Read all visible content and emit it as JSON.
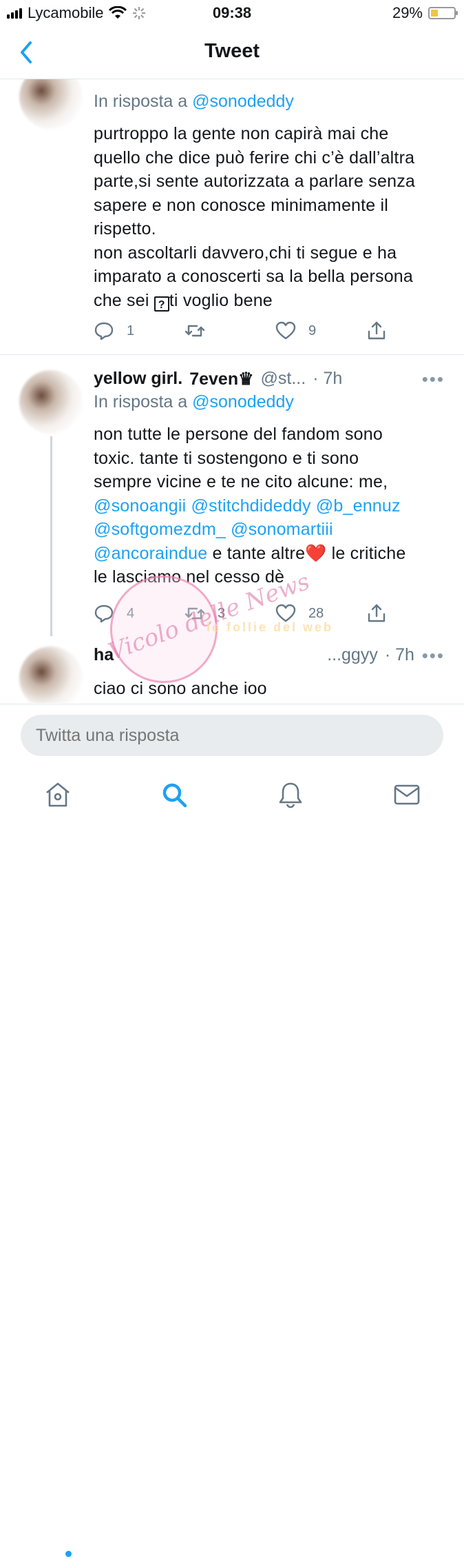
{
  "status_bar": {
    "carrier": "Lycamobile",
    "time": "09:38",
    "battery": "29%",
    "battery_level": 0.29
  },
  "nav": {
    "title": "Tweet"
  },
  "tweets": [
    {
      "reply_to_prefix": "In risposta a",
      "reply_to_handle": "@sonodeddy",
      "body_lines": [
        "purtroppo la gente non capirà mai che",
        "quello che dice può ferire chi c’è dall’altra",
        "parte,si sente autorizzata a parlare senza",
        "sapere e non conosce minimamente il",
        "rispetto.",
        "non ascoltarli davvero,chi ti segue e ha",
        "imparato a conoscerti sa la bella persona",
        "che sei"
      ],
      "body_tail": "ti voglio bene",
      "unknown_glyph": "?",
      "replies": "1",
      "likes": "9"
    },
    {
      "name": "yellow girl.",
      "name_tail": "7even♛",
      "handle": "@st...",
      "time": "· 7h",
      "more": "•••",
      "reply_to_prefix": "In risposta a",
      "reply_to_handle": "@sonodeddy",
      "body_lines": [
        "non tutte le persone del fandom sono",
        "toxic. tante ti sostengono e ti sono",
        "sempre vicine e te ne cito alcune: me,"
      ],
      "mentions_line1": "@sonoangii @stitchdideddy @b_ennuz",
      "mentions_line2": "@softgomezdm_ @sonomartiii",
      "mention_last": "@ancoraindue",
      "after_mention": " e tante altre",
      "heart_emoji": "❤️",
      "line_end": " le critiche",
      "last_line": "le lasciamo nel cesso dè",
      "replies": "4",
      "retweets": "3",
      "likes": "28"
    },
    {
      "name": "ha",
      "handle": "...ggyy",
      "time": "· 7h",
      "more": "•••",
      "body_lines": [
        "ciao ci sono anche ioo"
      ]
    }
  ],
  "watermark": {
    "text": "Vicolo delle News",
    "strip": "le follie del web"
  },
  "compose": {
    "placeholder": "Twitta una risposta"
  },
  "tabs": [
    "home-icon",
    "search-icon",
    "notifications-icon",
    "messages-icon"
  ],
  "colors": {
    "accent": "#1da1f2",
    "muted": "#657786",
    "text": "#14171a"
  }
}
